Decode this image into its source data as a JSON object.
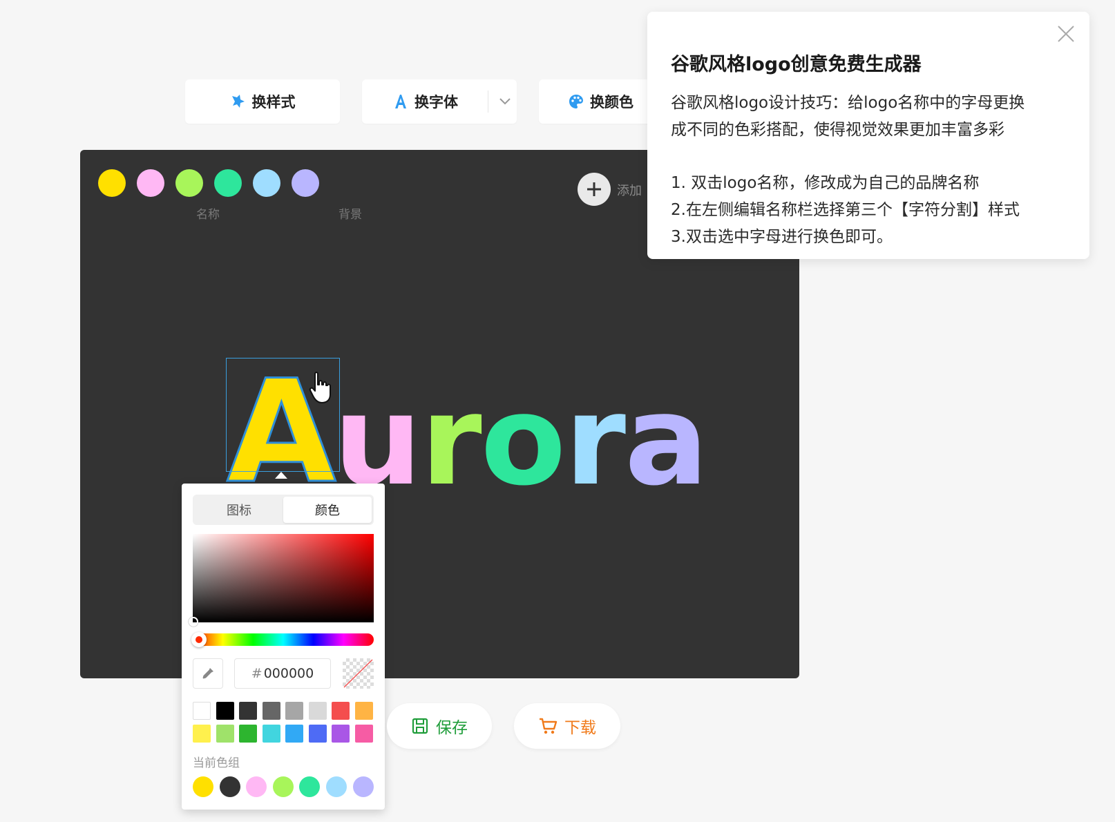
{
  "toolbar": {
    "style_label": "换样式",
    "font_label": "换字体",
    "color_label": "换颜色",
    "style_icon": "sparkle-icon",
    "font_icon": "letter-a-icon",
    "color_icon": "palette-icon"
  },
  "canvas": {
    "background": "#333333",
    "palette": [
      {
        "color": "#FFE000"
      },
      {
        "color": "#FFB8F4"
      },
      {
        "color": "#A8F55A"
      },
      {
        "color": "#2EE69C"
      },
      {
        "color": "#9FDDFF"
      },
      {
        "color": "#B9B6FF"
      }
    ],
    "palette_name_label": "名称",
    "palette_bg_label": "背景",
    "add_label": "添加"
  },
  "logo": {
    "letters": [
      {
        "char": "A",
        "color": "#FFE000"
      },
      {
        "char": "u",
        "color": "#FFB8F4"
      },
      {
        "char": "r",
        "color": "#A8F55A"
      },
      {
        "char": "o",
        "color": "#2EE69C"
      },
      {
        "char": "r",
        "color": "#9FDDFF"
      },
      {
        "char": "a",
        "color": "#B9B6FF"
      }
    ]
  },
  "picker": {
    "tab_icon": "图标",
    "tab_color": "颜色",
    "hex_hash": "#",
    "hex_value": "000000",
    "swatches": [
      "#FFFFFF",
      "#000000",
      "#333333",
      "#666666",
      "#A6A6A6",
      "#D9D9D9",
      "#F44E4E",
      "#FFB444",
      "#FFF04D",
      "#9FE26A",
      "#2DB52F",
      "#41D5DF",
      "#31A9F5",
      "#4E6BF5",
      "#A957E6",
      "#F65CA4"
    ],
    "current_label": "当前色组",
    "current_colors": [
      "#FFE000",
      "#333333",
      "#FFB8F4",
      "#A8F55A",
      "#2EE69C",
      "#9FDDFF",
      "#B9B6FF"
    ]
  },
  "actions": {
    "save_label": "保存",
    "download_label": "下载"
  },
  "tips": {
    "title": "谷歌风格logo创意免费生成器",
    "intro_line1": "谷歌风格logo设计技巧：给logo名称中的字母更换",
    "intro_line2": "成不同的色彩搭配，使得视觉效果更加丰富多彩",
    "step1": "1. 双击logo名称，修改成为自己的品牌名称",
    "step2": "2.在左侧编辑名称栏选择第三个【字符分割】样式",
    "step3": "3.双击选中字母进行换色即可。"
  }
}
